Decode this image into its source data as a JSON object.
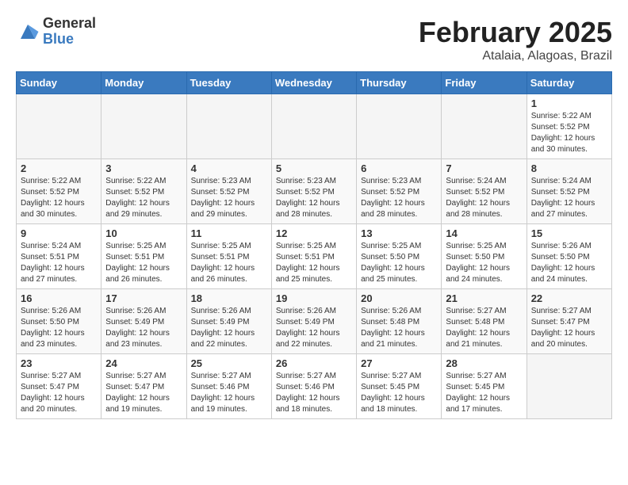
{
  "header": {
    "logo_general": "General",
    "logo_blue": "Blue",
    "month_title": "February 2025",
    "location": "Atalaia, Alagoas, Brazil"
  },
  "weekdays": [
    "Sunday",
    "Monday",
    "Tuesday",
    "Wednesday",
    "Thursday",
    "Friday",
    "Saturday"
  ],
  "weeks": [
    [
      {
        "day": "",
        "info": ""
      },
      {
        "day": "",
        "info": ""
      },
      {
        "day": "",
        "info": ""
      },
      {
        "day": "",
        "info": ""
      },
      {
        "day": "",
        "info": ""
      },
      {
        "day": "",
        "info": ""
      },
      {
        "day": "1",
        "info": "Sunrise: 5:22 AM\nSunset: 5:52 PM\nDaylight: 12 hours\nand 30 minutes."
      }
    ],
    [
      {
        "day": "2",
        "info": "Sunrise: 5:22 AM\nSunset: 5:52 PM\nDaylight: 12 hours\nand 30 minutes."
      },
      {
        "day": "3",
        "info": "Sunrise: 5:22 AM\nSunset: 5:52 PM\nDaylight: 12 hours\nand 29 minutes."
      },
      {
        "day": "4",
        "info": "Sunrise: 5:23 AM\nSunset: 5:52 PM\nDaylight: 12 hours\nand 29 minutes."
      },
      {
        "day": "5",
        "info": "Sunrise: 5:23 AM\nSunset: 5:52 PM\nDaylight: 12 hours\nand 28 minutes."
      },
      {
        "day": "6",
        "info": "Sunrise: 5:23 AM\nSunset: 5:52 PM\nDaylight: 12 hours\nand 28 minutes."
      },
      {
        "day": "7",
        "info": "Sunrise: 5:24 AM\nSunset: 5:52 PM\nDaylight: 12 hours\nand 28 minutes."
      },
      {
        "day": "8",
        "info": "Sunrise: 5:24 AM\nSunset: 5:52 PM\nDaylight: 12 hours\nand 27 minutes."
      }
    ],
    [
      {
        "day": "9",
        "info": "Sunrise: 5:24 AM\nSunset: 5:51 PM\nDaylight: 12 hours\nand 27 minutes."
      },
      {
        "day": "10",
        "info": "Sunrise: 5:25 AM\nSunset: 5:51 PM\nDaylight: 12 hours\nand 26 minutes."
      },
      {
        "day": "11",
        "info": "Sunrise: 5:25 AM\nSunset: 5:51 PM\nDaylight: 12 hours\nand 26 minutes."
      },
      {
        "day": "12",
        "info": "Sunrise: 5:25 AM\nSunset: 5:51 PM\nDaylight: 12 hours\nand 25 minutes."
      },
      {
        "day": "13",
        "info": "Sunrise: 5:25 AM\nSunset: 5:50 PM\nDaylight: 12 hours\nand 25 minutes."
      },
      {
        "day": "14",
        "info": "Sunrise: 5:25 AM\nSunset: 5:50 PM\nDaylight: 12 hours\nand 24 minutes."
      },
      {
        "day": "15",
        "info": "Sunrise: 5:26 AM\nSunset: 5:50 PM\nDaylight: 12 hours\nand 24 minutes."
      }
    ],
    [
      {
        "day": "16",
        "info": "Sunrise: 5:26 AM\nSunset: 5:50 PM\nDaylight: 12 hours\nand 23 minutes."
      },
      {
        "day": "17",
        "info": "Sunrise: 5:26 AM\nSunset: 5:49 PM\nDaylight: 12 hours\nand 23 minutes."
      },
      {
        "day": "18",
        "info": "Sunrise: 5:26 AM\nSunset: 5:49 PM\nDaylight: 12 hours\nand 22 minutes."
      },
      {
        "day": "19",
        "info": "Sunrise: 5:26 AM\nSunset: 5:49 PM\nDaylight: 12 hours\nand 22 minutes."
      },
      {
        "day": "20",
        "info": "Sunrise: 5:26 AM\nSunset: 5:48 PM\nDaylight: 12 hours\nand 21 minutes."
      },
      {
        "day": "21",
        "info": "Sunrise: 5:27 AM\nSunset: 5:48 PM\nDaylight: 12 hours\nand 21 minutes."
      },
      {
        "day": "22",
        "info": "Sunrise: 5:27 AM\nSunset: 5:47 PM\nDaylight: 12 hours\nand 20 minutes."
      }
    ],
    [
      {
        "day": "23",
        "info": "Sunrise: 5:27 AM\nSunset: 5:47 PM\nDaylight: 12 hours\nand 20 minutes."
      },
      {
        "day": "24",
        "info": "Sunrise: 5:27 AM\nSunset: 5:47 PM\nDaylight: 12 hours\nand 19 minutes."
      },
      {
        "day": "25",
        "info": "Sunrise: 5:27 AM\nSunset: 5:46 PM\nDaylight: 12 hours\nand 19 minutes."
      },
      {
        "day": "26",
        "info": "Sunrise: 5:27 AM\nSunset: 5:46 PM\nDaylight: 12 hours\nand 18 minutes."
      },
      {
        "day": "27",
        "info": "Sunrise: 5:27 AM\nSunset: 5:45 PM\nDaylight: 12 hours\nand 18 minutes."
      },
      {
        "day": "28",
        "info": "Sunrise: 5:27 AM\nSunset: 5:45 PM\nDaylight: 12 hours\nand 17 minutes."
      },
      {
        "day": "",
        "info": ""
      }
    ]
  ]
}
